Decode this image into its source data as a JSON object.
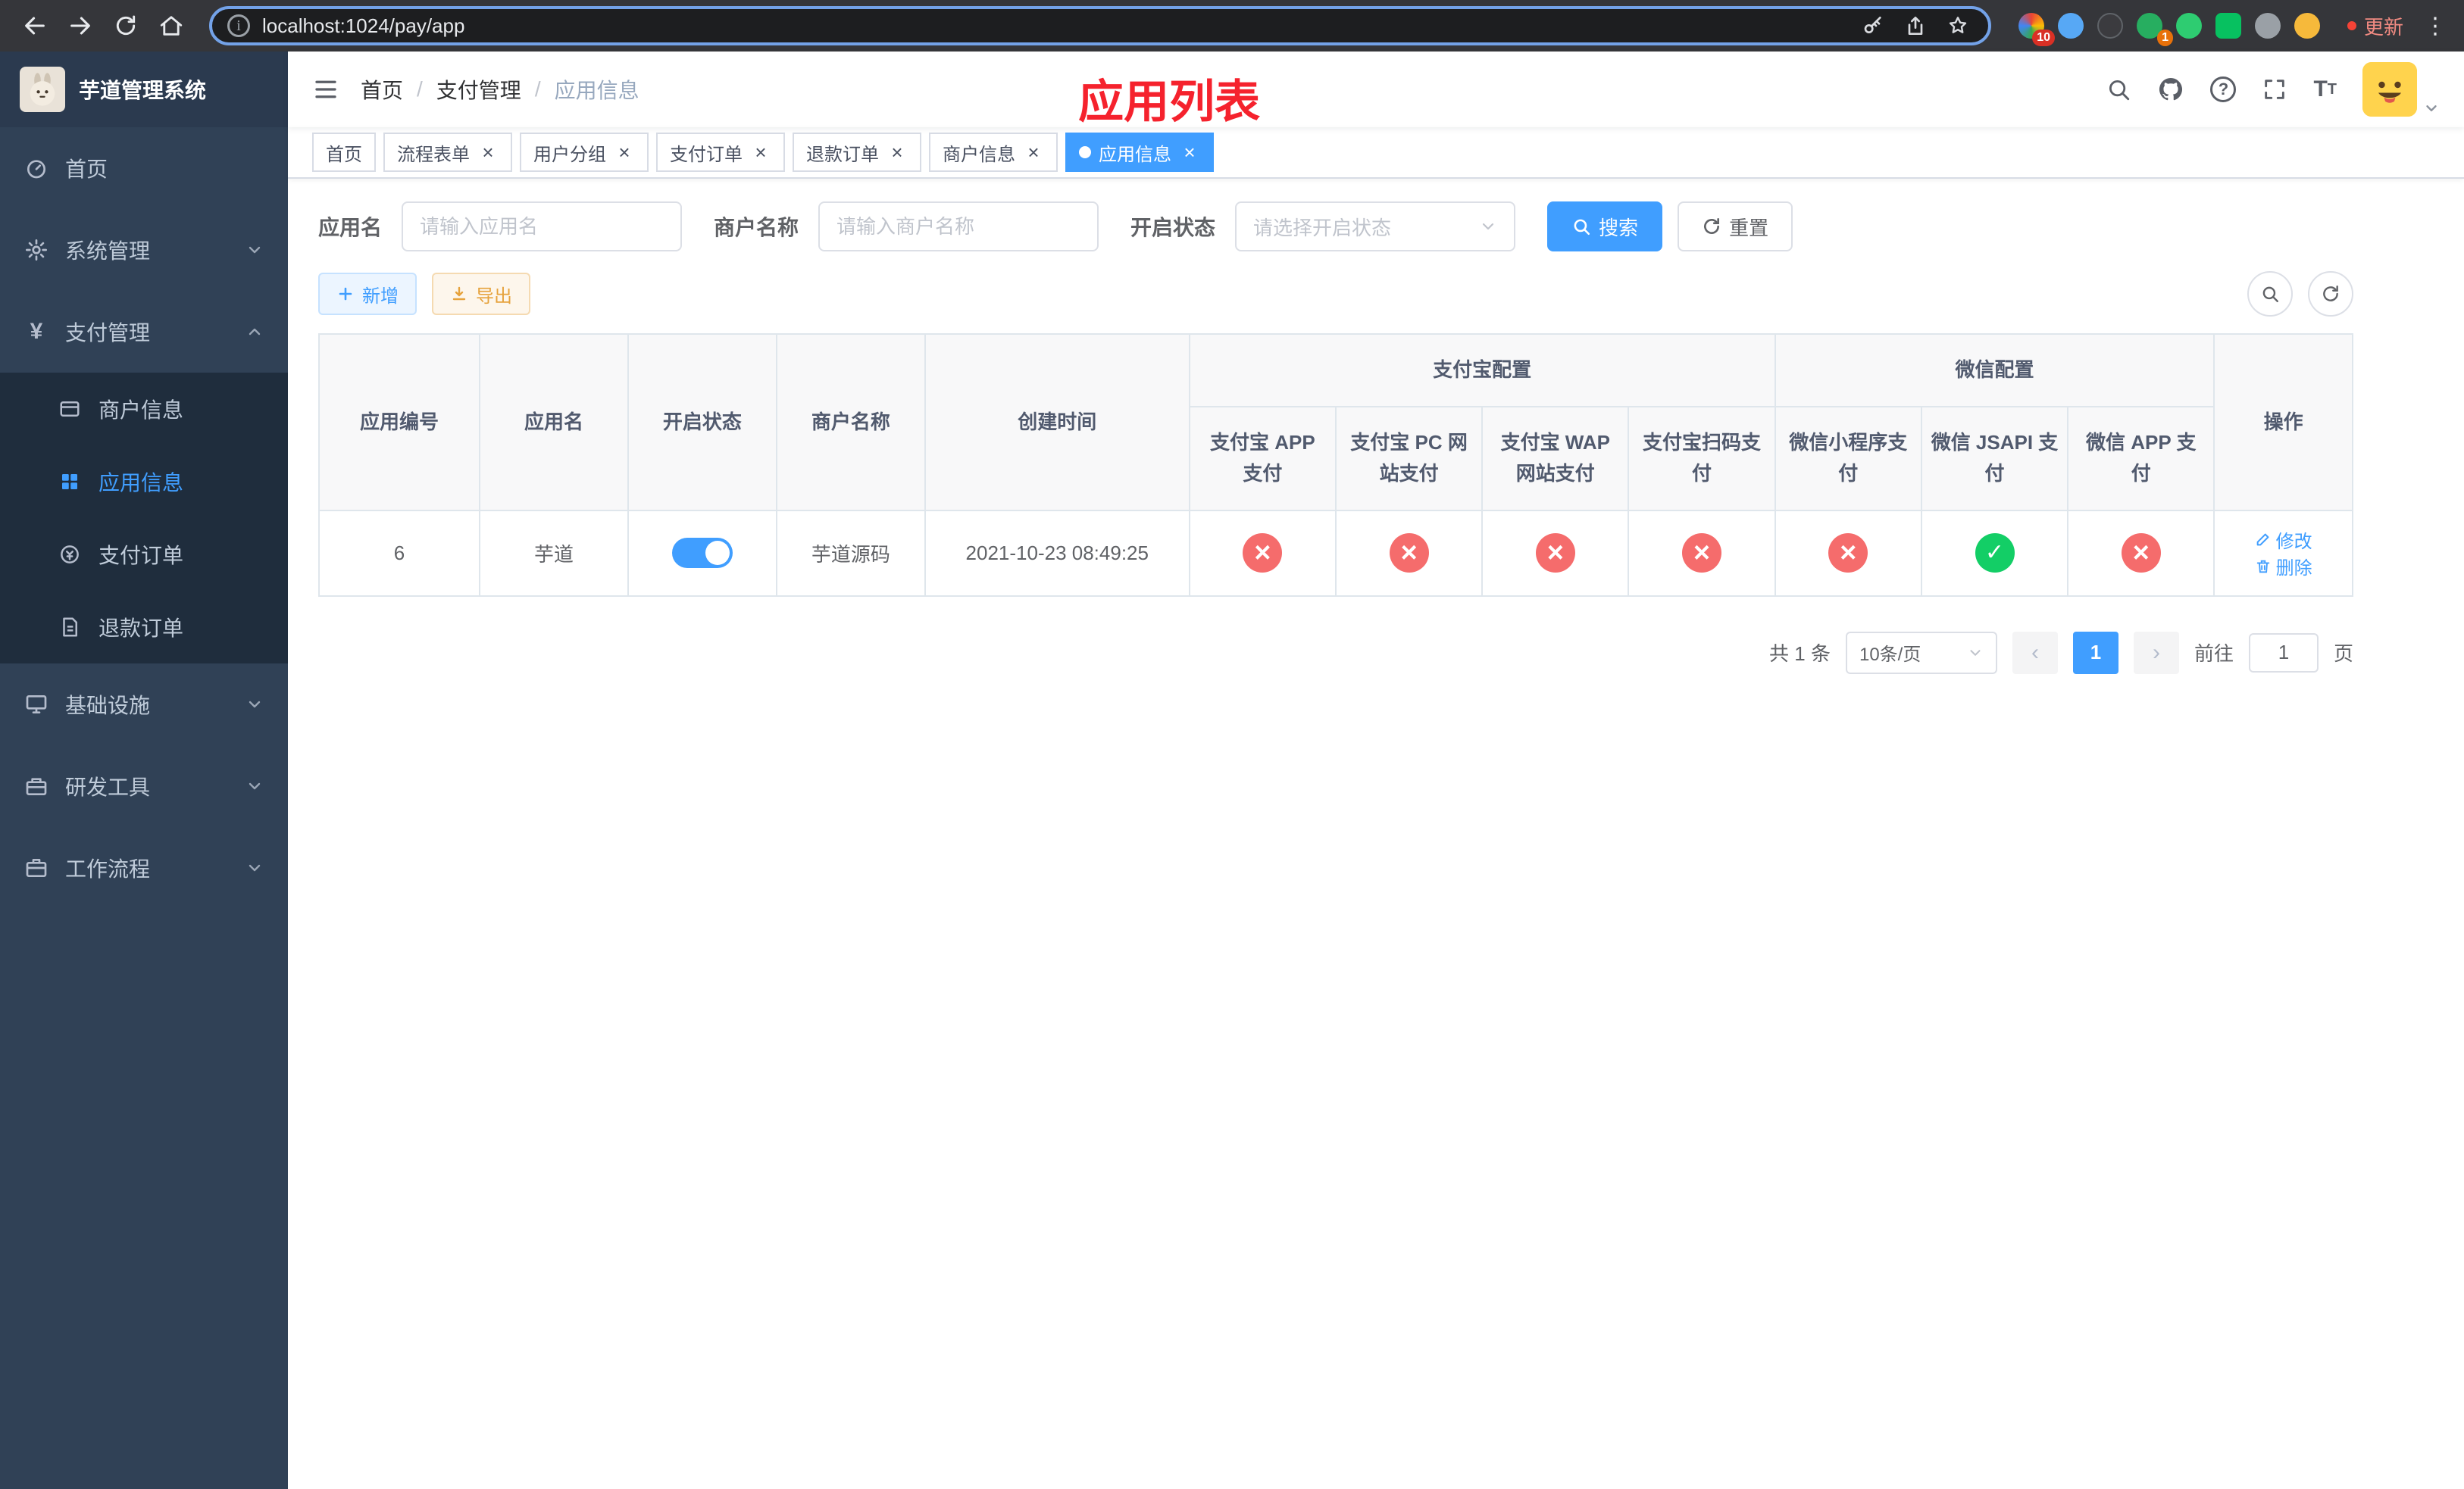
{
  "colors": {
    "primary": "#409eff",
    "success": "#13ce66",
    "danger": "#f56c6c",
    "warning": "#e6a23c",
    "annotation_red": "#f5222d",
    "sidebar_bg": "#304156",
    "submenu_bg": "#1f2d3d"
  },
  "browser": {
    "url": "localhost:1024/pay/app",
    "update_label": "更新",
    "ext_badge_1": "10",
    "ext_badge_2": "1"
  },
  "app": {
    "logo_title": "芋道管理系统",
    "annotation": "应用列表"
  },
  "sidebar": {
    "items": [
      {
        "label": "首页",
        "icon": "dashboard-icon"
      },
      {
        "label": "系统管理",
        "icon": "gear-icon",
        "collapsible": true
      },
      {
        "label": "支付管理",
        "icon": "yen-icon",
        "collapsible": true,
        "expanded": true,
        "children": [
          {
            "label": "商户信息",
            "icon": "credit-card-icon"
          },
          {
            "label": "应用信息",
            "icon": "grid-icon",
            "active": true
          },
          {
            "label": "支付订单",
            "icon": "pay-order-icon"
          },
          {
            "label": "退款订单",
            "icon": "refund-order-icon"
          }
        ]
      },
      {
        "label": "基础设施",
        "icon": "monitor-icon",
        "collapsible": true
      },
      {
        "label": "研发工具",
        "icon": "toolbox-icon",
        "collapsible": true
      },
      {
        "label": "工作流程",
        "icon": "workflow-icon",
        "collapsible": true
      }
    ]
  },
  "breadcrumb": {
    "items": [
      "首页",
      "支付管理",
      "应用信息"
    ],
    "separator": "/"
  },
  "navbar_icons": [
    "search-icon",
    "github-icon",
    "help-icon",
    "fullscreen-icon",
    "font-size-icon",
    "avatar",
    "chevron-down-icon"
  ],
  "tabs": [
    {
      "label": "首页",
      "closable": false,
      "active": false
    },
    {
      "label": "流程表单",
      "closable": true,
      "active": false
    },
    {
      "label": "用户分组",
      "closable": true,
      "active": false
    },
    {
      "label": "支付订单",
      "closable": true,
      "active": false
    },
    {
      "label": "退款订单",
      "closable": true,
      "active": false
    },
    {
      "label": "商户信息",
      "closable": true,
      "active": false
    },
    {
      "label": "应用信息",
      "closable": true,
      "active": true
    }
  ],
  "filters": {
    "app_name_label": "应用名",
    "app_name_placeholder": "请输入应用名",
    "merchant_label": "商户名称",
    "merchant_placeholder": "请输入商户名称",
    "status_label": "开启状态",
    "status_placeholder": "请选择开启状态",
    "search_button": {
      "label": "搜索",
      "icon": "search-icon"
    },
    "reset_button": {
      "label": "重置",
      "icon": "refresh-icon"
    }
  },
  "toolbar": {
    "add_button": {
      "label": "新增",
      "icon": "plus-icon"
    },
    "export_button": {
      "label": "导出",
      "icon": "download-icon"
    },
    "right_icons": [
      "search-icon",
      "refresh-icon"
    ]
  },
  "table": {
    "headers": {
      "app_id": "应用编号",
      "app_name": "应用名",
      "status": "开启状态",
      "merchant": "商户名称",
      "create_time": "创建时间",
      "alipay_group": "支付宝配置",
      "wechat_group": "微信配置",
      "alipay_app": "支付宝 APP 支付",
      "alipay_pc": "支付宝 PC 网站支付",
      "alipay_wap": "支付宝 WAP 网站支付",
      "alipay_qr": "支付宝扫码支付",
      "wx_lite": "微信小程序支付",
      "wx_jsapi": "微信 JSAPI 支付",
      "wx_app": "微信 APP 支付",
      "actions": "操作"
    },
    "row": {
      "app_id": "6",
      "app_name": "芋道",
      "status_on": true,
      "merchant": "芋道源码",
      "create_time": "2021-10-23 08:49:25",
      "configs": {
        "alipay_app": false,
        "alipay_pc": false,
        "alipay_wap": false,
        "alipay_qr": false,
        "wx_lite": false,
        "wx_jsapi": true,
        "wx_app": false
      },
      "edit_label": "修改",
      "delete_label": "删除"
    }
  },
  "pagination": {
    "total_label": "共 1 条",
    "page_size_label": "10条/页",
    "current_page": "1",
    "goto_label": "前往",
    "goto_value": "1",
    "page_unit": "页"
  }
}
